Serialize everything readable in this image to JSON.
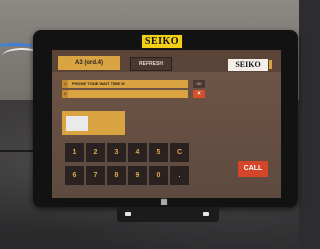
{
  "brand_badge": "SEIKO",
  "screen": {
    "title": "A3 (ord.4)",
    "refresh_label": "REFRESH",
    "logo_text": "SEIKO",
    "row1": {
      "number": "1",
      "text": "PHONE TONE WAIT TIME M"
    },
    "row2": {
      "number": "2"
    },
    "row1_action": "OK",
    "row2_action": "×",
    "keypad": [
      "1",
      "2",
      "3",
      "4",
      "5",
      "C",
      "6",
      "7",
      "8",
      "9",
      "0",
      "."
    ],
    "call_label": "CALL"
  },
  "colors": {
    "accent_yellow": "#f2d017",
    "panel_amber": "#d9a441",
    "call_red": "#d4462a"
  }
}
